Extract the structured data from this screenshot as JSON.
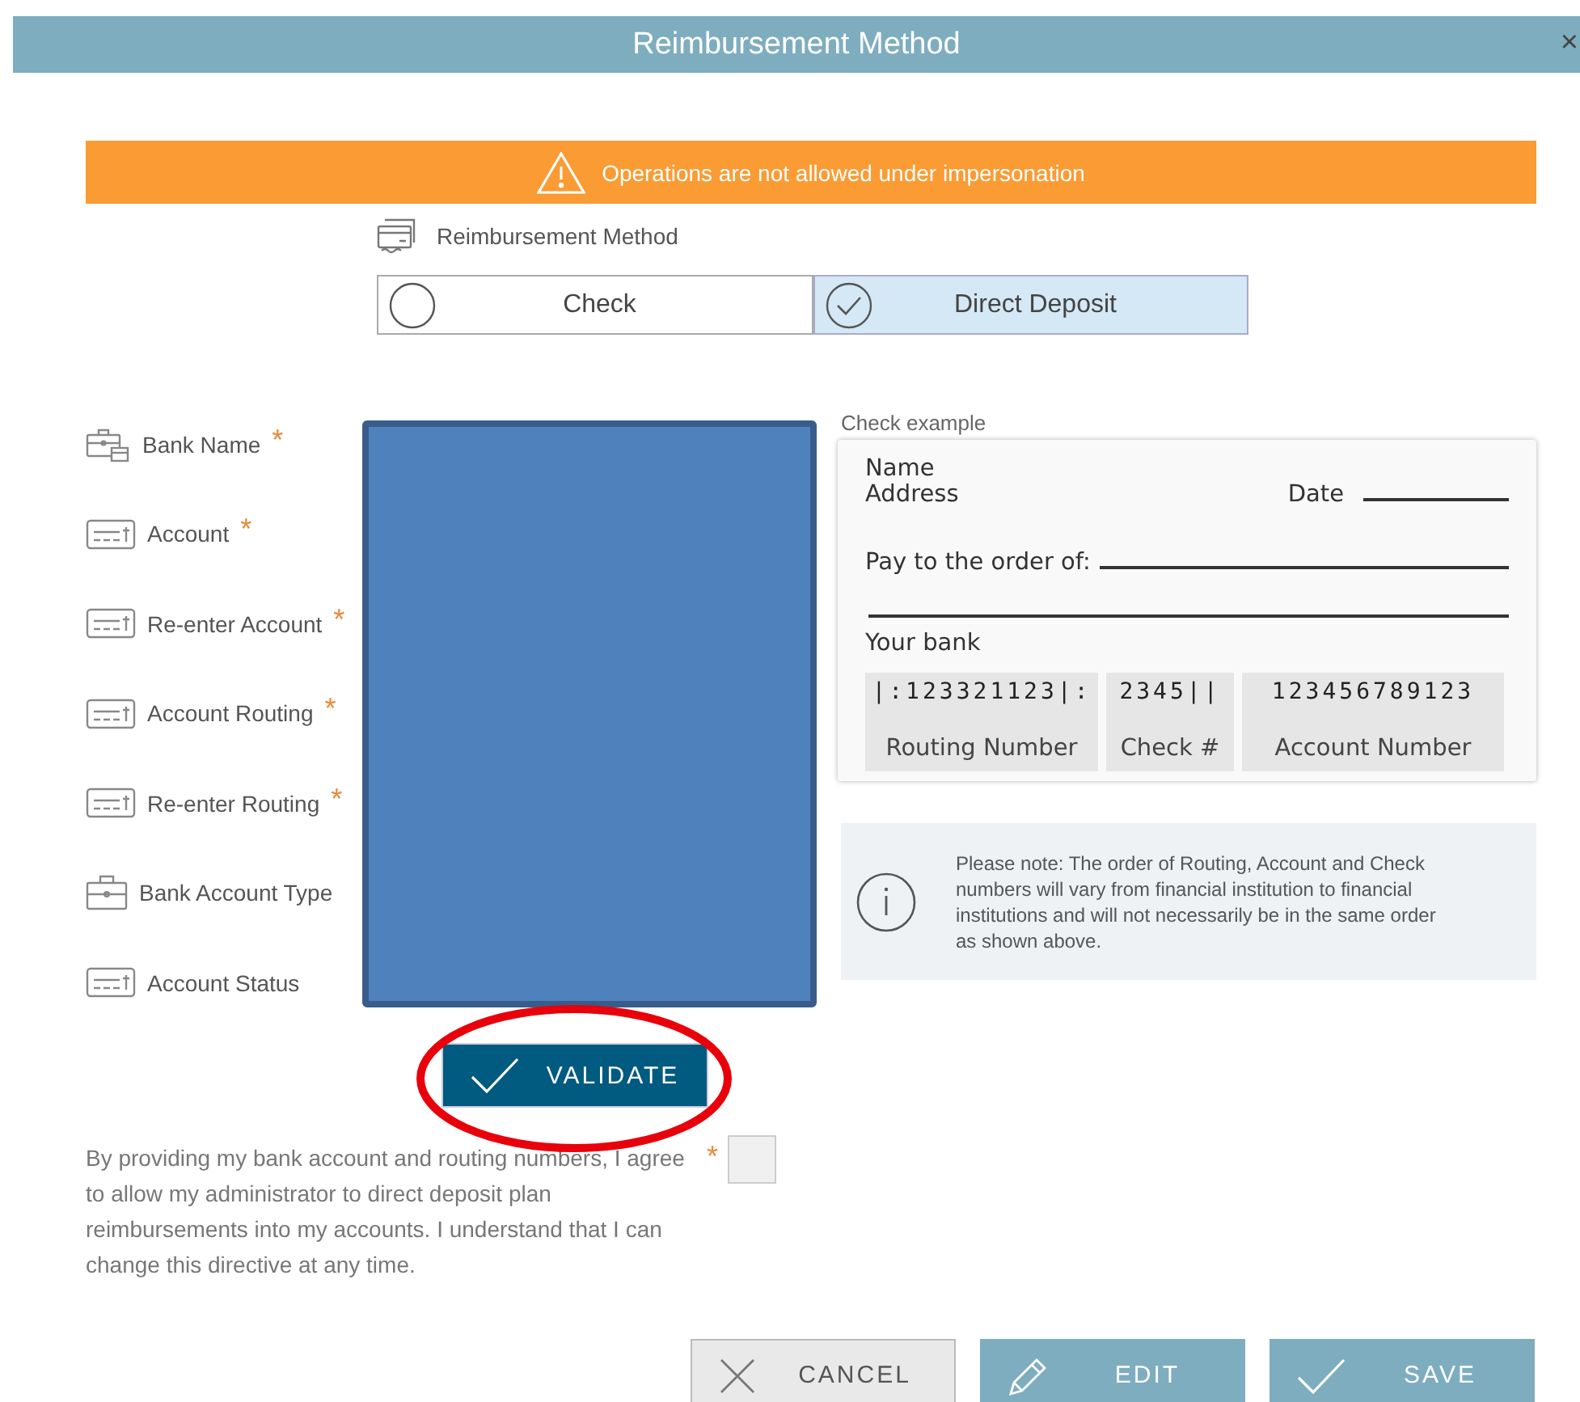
{
  "dialog": {
    "title": "Reimbursement Method",
    "close": "×"
  },
  "banner": {
    "text": "Operations are not allowed under impersonation"
  },
  "method": {
    "label": "Reimbursement Method",
    "options": [
      {
        "label": "Check",
        "selected": false
      },
      {
        "label": "Direct Deposit",
        "selected": true
      }
    ]
  },
  "fields": [
    {
      "label": "Bank Name",
      "required_mark": "*",
      "kind": "bank"
    },
    {
      "label": "Account",
      "required_mark": "*",
      "kind": "entry"
    },
    {
      "label": "Re-enter Account",
      "required_mark": "*",
      "kind": "entry"
    },
    {
      "label": "Account Routing",
      "required_mark": "*",
      "kind": "entry"
    },
    {
      "label": "Re-enter Routing",
      "required_mark": "*",
      "kind": "entry"
    },
    {
      "label": "Bank Account Type",
      "kind": "choice"
    },
    {
      "label": "Account Status",
      "kind": "entry"
    }
  ],
  "redaction": {
    "kind": "block"
  },
  "annotation": {
    "kind": "ellipse"
  },
  "validate_button": "VALIDATE",
  "check_example": {
    "title": "Check example",
    "name": "Name",
    "address": "Address",
    "date": "Date",
    "pay_to": "Pay to the order of:",
    "bank": "Your bank",
    "micr": [
      {
        "digits": "|:123321123|:",
        "caption": "Routing Number"
      },
      {
        "digits": "2345||",
        "caption": "Check #"
      },
      {
        "digits": "123456789123",
        "caption": "Account Number"
      }
    ]
  },
  "note": "Please note: The order of Routing, Account and Check numbers will vary from financial institution to financial institutions and will not necessarily be in the same order as shown above.",
  "consent": {
    "text": "By providing my bank account and routing numbers, I agree to allow my administrator to direct deposit plan reimbursements into my accounts. I understand that I can change this directive at any time.",
    "required_mark": "*",
    "checked": false
  },
  "buttons": [
    {
      "label": "CANCEL",
      "kind": "cancel"
    },
    {
      "label": "EDIT",
      "kind": "edit"
    },
    {
      "label": "SAVE",
      "kind": "save"
    }
  ]
}
